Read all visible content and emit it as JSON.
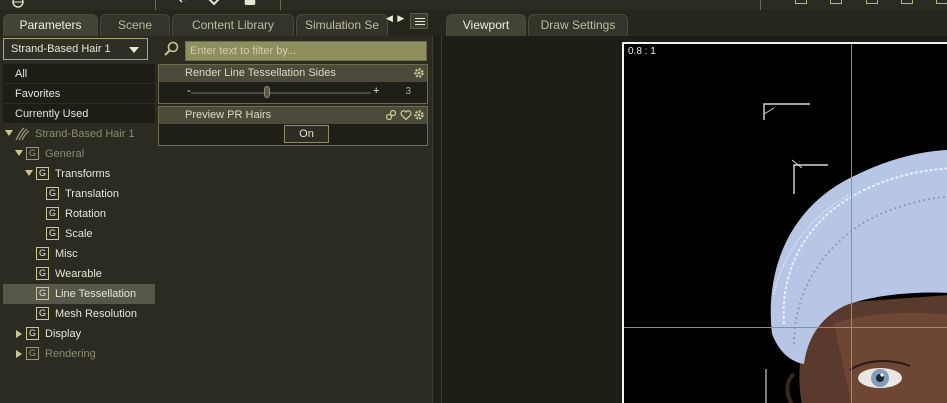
{
  "tabs_left": [
    {
      "label": "Parameters",
      "active": true
    },
    {
      "label": "Scene",
      "active": false
    },
    {
      "label": "Content Library",
      "active": false
    },
    {
      "label": "Simulation Se",
      "active": false
    }
  ],
  "tab_scroll_arrows": "◀ ▶",
  "tabs_right": [
    {
      "label": "Viewport",
      "active": true
    },
    {
      "label": "Draw Settings",
      "active": false
    }
  ],
  "node_selector": {
    "value": "Strand-Based Hair 1"
  },
  "filter": {
    "placeholder": "Enter text to filter by..."
  },
  "quick_filters": [
    "All",
    "Favorites",
    "Currently Used"
  ],
  "tree": {
    "root": "Strand-Based Hair 1",
    "general": "General",
    "transforms": "Transforms",
    "translation": "Translation",
    "rotation": "Rotation",
    "scale": "Scale",
    "misc": "Misc",
    "wearable": "Wearable",
    "line_tessellation": "Line Tessellation",
    "mesh_resolution": "Mesh Resolution",
    "display": "Display",
    "rendering": "Rendering",
    "group_glyph": "G"
  },
  "params": {
    "render_sides": {
      "label": "Render Line Tessellation Sides",
      "value": "3",
      "minus": "-",
      "plus": "+",
      "fraction": 0.42
    },
    "preview_pr": {
      "label": "Preview PR Hairs",
      "value": "On"
    }
  },
  "viewport": {
    "ratio": "0.8 : 1"
  },
  "colors": {
    "accent": "#c9c690",
    "panel": "#2b2b22",
    "selected": "#57574a",
    "hair": "#b8c6e6"
  }
}
